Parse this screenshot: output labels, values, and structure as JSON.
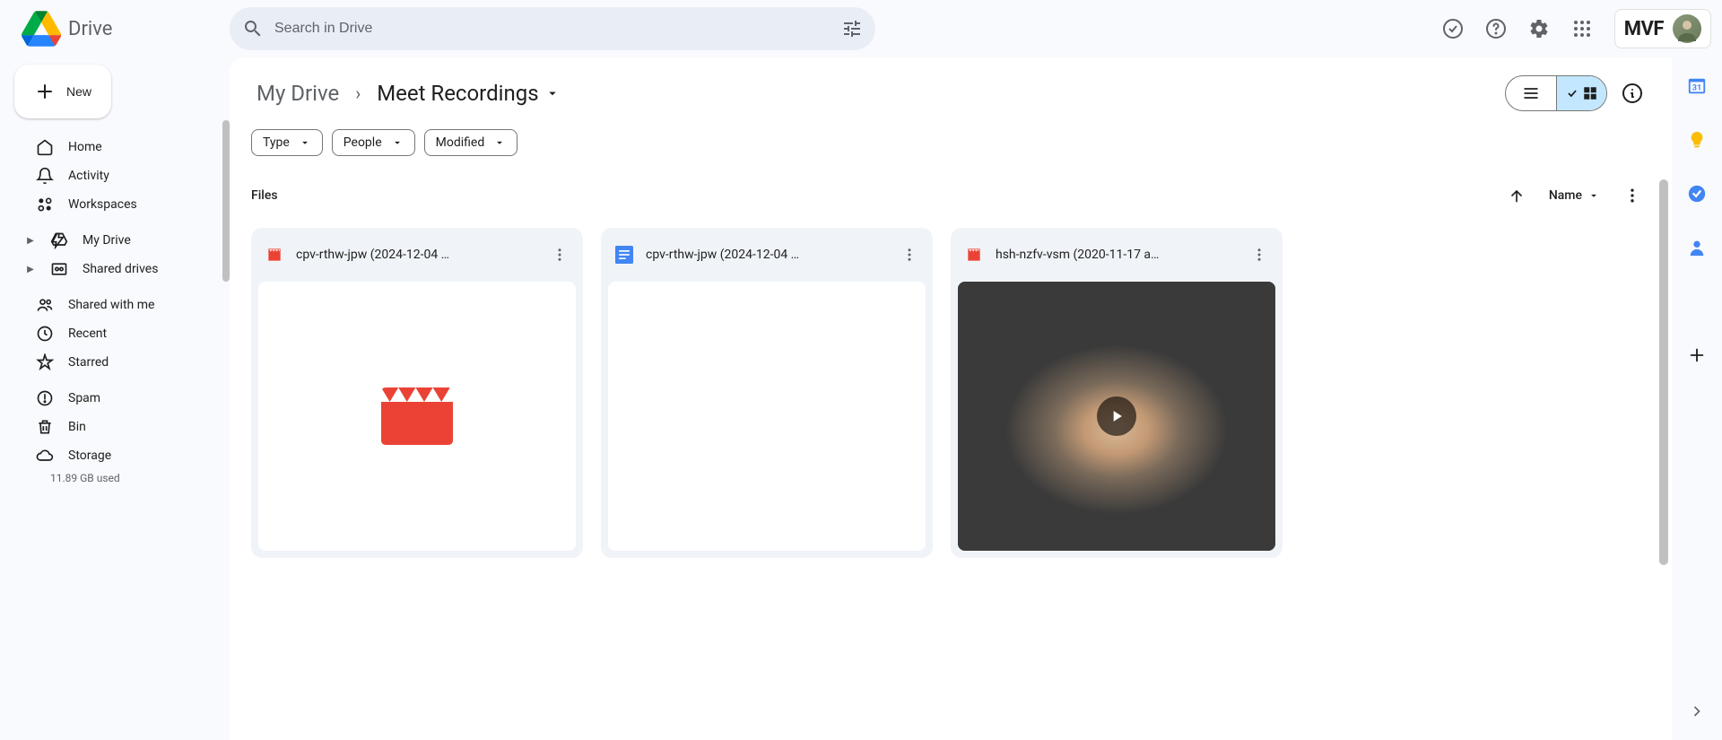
{
  "header": {
    "product": "Drive",
    "search_placeholder": "Search in Drive",
    "org": "MVF"
  },
  "sidebar": {
    "new_label": "New",
    "items_a": [
      {
        "label": "Home",
        "icon": "home"
      },
      {
        "label": "Activity",
        "icon": "activity"
      },
      {
        "label": "Workspaces",
        "icon": "workspaces"
      }
    ],
    "items_b": [
      {
        "label": "My Drive",
        "icon": "mydrive"
      },
      {
        "label": "Shared drives",
        "icon": "shareddrives"
      }
    ],
    "items_c": [
      {
        "label": "Shared with me",
        "icon": "sharedwithme"
      },
      {
        "label": "Recent",
        "icon": "recent"
      },
      {
        "label": "Starred",
        "icon": "starred"
      }
    ],
    "items_d": [
      {
        "label": "Spam",
        "icon": "spam"
      },
      {
        "label": "Bin",
        "icon": "bin"
      },
      {
        "label": "Storage",
        "icon": "storage"
      }
    ],
    "storage_used": "11.89 GB used"
  },
  "breadcrumb": {
    "parent": "My Drive",
    "current": "Meet Recordings"
  },
  "filters": [
    {
      "label": "Type"
    },
    {
      "label": "People"
    },
    {
      "label": "Modified"
    }
  ],
  "section_label": "Files",
  "sort_label": "Name",
  "files": [
    {
      "name": "cpv-rthw-jpw (2024-12-04 …",
      "type": "video",
      "preview": "video-icon"
    },
    {
      "name": "cpv-rthw-jpw (2024-12-04 …",
      "type": "doc",
      "preview": "blank"
    },
    {
      "name": "hsh-nzfv-vsm (2020-11-17 a…",
      "type": "video",
      "preview": "video-thumb"
    }
  ]
}
